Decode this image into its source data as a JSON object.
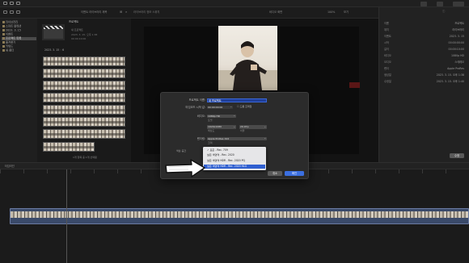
{
  "toolbar": {
    "title": "이벤트 라이브러리 제목",
    "center_label": "라이브러리 정보 스위치",
    "right_label": "비디오 화면",
    "zoom": "100%",
    "view_label": "보기"
  },
  "sidebar": {
    "items": [
      {
        "label": "라이브러리"
      },
      {
        "label": "스마트 컬렉션"
      },
      {
        "label": "2023. 3. 15"
      },
      {
        "label": "이벤트"
      },
      {
        "label": "프로젝트 목록"
      },
      {
        "label": "즐겨찾기"
      },
      {
        "label": "키워드"
      },
      {
        "label": "새 폴더"
      }
    ]
  },
  "browser": {
    "clip_title": "프로젝트",
    "clip_sub": "새 프로젝트",
    "clip_meta": "2023. 3. 15. 오후 1:38",
    "clip_meta2": "00:00:10:00",
    "group_label": "2023. 3. 15 ◦ 6",
    "footer": "1개 항목 중 1개 선택됨"
  },
  "inspector": {
    "rows": [
      {
        "label": "이름",
        "value": "프로젝트"
      },
      {
        "label": "위치",
        "value": "라이브러리"
      },
      {
        "label": "이벤트",
        "value": "2023. 3. 15"
      },
      {
        "label": "시작",
        "value": "00:00:00:00"
      },
      {
        "label": "길이",
        "value": "00:00:10:00"
      },
      {
        "label": "비디오",
        "value": "1080p HD"
      },
      {
        "label": "오디오",
        "value": "스테레오"
      },
      {
        "label": "렌더",
        "value": "Apple ProRes"
      },
      {
        "label": "생성일",
        "value": "2023. 3. 15. 오후 1:38"
      },
      {
        "label": "수정일",
        "value": "2023. 3. 15. 오후 1:40"
      }
    ],
    "modify_button": "수정"
  },
  "timeline": {
    "label": "타임라인",
    "project": "프로젝트"
  },
  "dialog": {
    "name_label": "프로젝트 이름:",
    "name_value": "새 프로젝트",
    "start_tc_label": "타임코드 시작 값:",
    "start_tc_value": "00:00:00:00",
    "dropframe": "드롭 프레임",
    "video_label": "비디오:",
    "video_format": "1080p HD",
    "format_sub": "포맷",
    "resolution": "1920x1080",
    "resolution_sub": "해상도",
    "rate": "29.97p",
    "rate_sub": "비율",
    "render_label": "렌더링:",
    "codec": "Apple ProRes 422",
    "codec_sub": "코덱",
    "color_label": "색상 공간",
    "cancel": "취소",
    "ok": "확인"
  },
  "dropdown": {
    "items": [
      {
        "label": "✓ 표준 - Rec. 709",
        "highlight": false
      },
      {
        "label": "넓은 색영역 - Rec. 2020",
        "highlight": false
      },
      {
        "label": "넓은 색영역 HDR - Rec. 2020 PQ",
        "highlight": false
      },
      {
        "label": "넓은 색영역 HDR - Rec. 2020 HLG",
        "highlight": true
      }
    ]
  },
  "colors": {
    "accent": "#3b6fe0",
    "highlight": "#2f5fd0",
    "dialog_bg": "#2b2b2b"
  }
}
